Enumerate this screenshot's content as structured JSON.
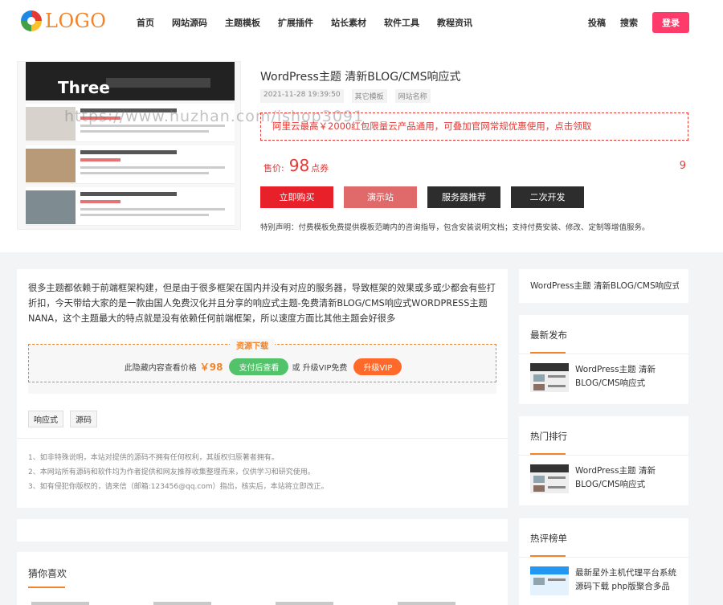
{
  "header": {
    "logo_text": "LOGO",
    "nav": [
      "首页",
      "网站源码",
      "主题模板",
      "扩展插件",
      "站长素材",
      "软件工具",
      "教程资讯"
    ],
    "right": [
      "投稿",
      "搜索"
    ],
    "login_label": "登录"
  },
  "product": {
    "thumb_big_text": "Three",
    "watermark": "https://www.huzhan.com/ishop3091",
    "title": "WordPress主题 清新BLOG/CMS响应式",
    "meta": [
      "2021-11-28 19:39:50",
      "其它模板",
      "网站名称"
    ],
    "promo": "阿里云最高￥2000红包限量云产品通用，可叠加官网常规优惠使用，点击领取",
    "price_label": "售价:",
    "price_value": "98",
    "price_unit": "点券",
    "sales_count": "9",
    "buttons": [
      "立即购买",
      "演示站",
      "服务器推荐",
      "二次开发"
    ],
    "notice": "特别声明：付费模板免费提供模板范畴内的咨询指导，包含安装说明文档；支持付费安装、修改、定制等增值服务。"
  },
  "article": {
    "intro": "很多主题都依赖于前端框架构建，但是由于很多框架在国内并没有对应的服务器，导致框架的效果或多或少都会有些打折扣，今天带给大家的是一款由国人免费汉化并且分享的响应式主题-免费清新BLOG/CMS响应式WORDPRESS主题NANA，这个主题最大的特点就是没有依赖任何前端框架，所以速度方面比其他主题会好很多",
    "download": {
      "title": "资源下载",
      "hidden_text": "此隐藏内容查看价格",
      "price": "￥98",
      "pay_label": "支付后查看",
      "or_text": "或 升级VIP免费",
      "vip_label": "升级VIP"
    },
    "tags": [
      "响应式",
      "源码"
    ],
    "rules": [
      "1、如非特殊说明，本站对提供的源码不拥有任何权利，其版权归原著者拥有。",
      "2、本网站所有源码和软件均为作者提供和网友推荐收集整理而来，仅供学习和研究使用。",
      "3、如有侵犯你版权的，请来信（邮箱:123456@qq.com）指出，核实后，本站将立即改正。"
    ]
  },
  "guess": {
    "title": "猜你喜欢"
  },
  "sidebar": {
    "current": "WordPress主题 清新BLOG/CMS响应式",
    "latest": {
      "title": "最新发布",
      "item": "WordPress主题 清新BLOG/CMS响应式"
    },
    "hot": {
      "title": "热门排行",
      "item": "WordPress主题 清新BLOG/CMS响应式"
    },
    "comments": {
      "title": "热评榜单",
      "item": "最新星外主机代理平台系统源码下载 php版聚合多品"
    }
  },
  "colors": {
    "accent": "#f0842c",
    "red": "#e7202a",
    "login": "#ff3b6b",
    "green": "#52c36b"
  }
}
